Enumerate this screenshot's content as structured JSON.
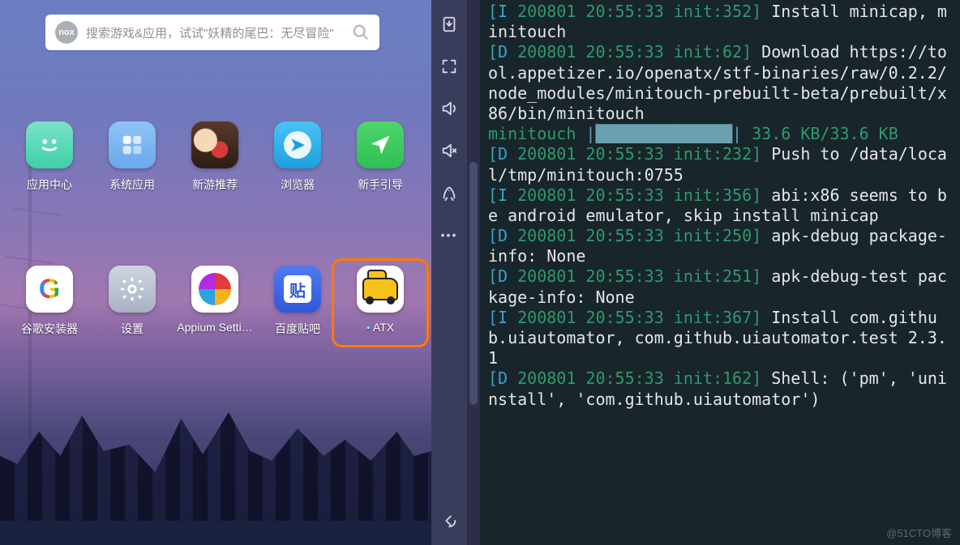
{
  "search": {
    "badge": "nox",
    "placeholder": "搜索游戏&应用，试试\"妖精的尾巴：无尽冒险\""
  },
  "apps": {
    "row1": [
      {
        "id": "app-center",
        "label": "应用中心",
        "icon": "nox"
      },
      {
        "id": "system-apps",
        "label": "系统应用",
        "icon": "sys"
      },
      {
        "id": "new-games",
        "label": "新游推荐",
        "icon": "game"
      },
      {
        "id": "browser",
        "label": "浏览器",
        "icon": "brow"
      },
      {
        "id": "newbie-guide",
        "label": "新手引导",
        "icon": "guide"
      }
    ],
    "row2": [
      {
        "id": "google-installer",
        "label": "谷歌安装器",
        "icon": "goog"
      },
      {
        "id": "settings",
        "label": "设置",
        "icon": "set"
      },
      {
        "id": "appium",
        "label": "Appium Setti…",
        "icon": "appi"
      },
      {
        "id": "baidu-tieba",
        "label": "百度贴吧",
        "icon": "tieba"
      },
      {
        "id": "atx",
        "label": "ATX",
        "icon": "atx",
        "selected": true
      }
    ]
  },
  "sidetool": {
    "apk": "APK",
    "items": [
      "apk-install",
      "fullscreen",
      "volume-up",
      "volume-down",
      "rocket",
      "more"
    ],
    "back": "back"
  },
  "terminal": {
    "lines": [
      {
        "lvl": "[I",
        "ts": " 200801 20:55:33 init:352]",
        "msg": " Install minicap, minitouch"
      },
      {
        "lvl": "[D",
        "ts": " 200801 20:55:33 init:62]",
        "msg": " Download https://tool.appetizer.io/openatx/stf-binaries/raw/0.2.2/node_modules/minitouch-prebuilt-beta/prebuilt/x86/bin/minitouch"
      },
      {
        "mini": "minitouch ",
        "bar": "|██████████████|",
        "kb": " 33.6 KB/33.6 KB"
      },
      {
        "lvl": "[D",
        "ts": " 200801 20:55:33 init:232]",
        "msg": " Push to /data/local/tmp/minitouch:0755"
      },
      {
        "lvl": "[I",
        "ts": " 200801 20:55:33 init:356]",
        "msg": " abi:x86 seems to be android emulator, skip install minicap"
      },
      {
        "lvl": "[D",
        "ts": " 200801 20:55:33 init:250]",
        "msg": " apk-debug package-info: None"
      },
      {
        "lvl": "[D",
        "ts": " 200801 20:55:33 init:251]",
        "msg": " apk-debug-test package-info: None"
      },
      {
        "lvl": "[I",
        "ts": " 200801 20:55:33 init:367]",
        "msg": " Install com.github.uiautomator, com.github.uiautomator.test 2.3.1"
      },
      {
        "lvl": "[D",
        "ts": " 200801 20:55:33 init:162]",
        "msg": " Shell: ('pm', 'uninstall', 'com.github.uiautomator')"
      }
    ]
  },
  "watermark": "@51CTO博客"
}
